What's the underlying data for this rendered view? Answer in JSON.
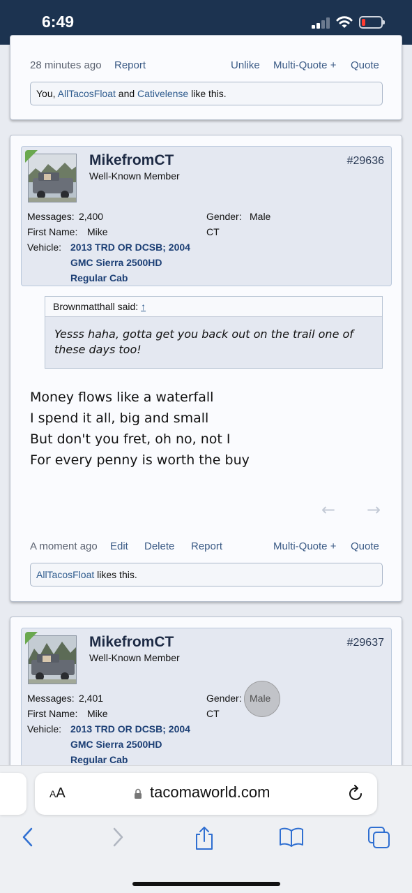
{
  "status_bar": {
    "time": "6:49",
    "battery_color": "#ff3b30"
  },
  "post_top": {
    "timestamp": "28 minutes ago",
    "actions_left": [
      "Report"
    ],
    "actions_right": [
      "Unlike",
      "Multi-Quote +",
      "Quote"
    ],
    "likes": {
      "prefix": "You, ",
      "user1": "AllTacosFloat",
      "joiner": " and ",
      "user2": "Cativelense",
      "suffix": " like this."
    }
  },
  "post_1": {
    "username": "MikefromCT",
    "user_title": "Well-Known Member",
    "post_number": "#29636",
    "messages_label": "Messages:",
    "messages_value": "2,400",
    "first_name_label": "First Name:",
    "first_name_value": "Mike",
    "vehicle_label": "Vehicle:",
    "vehicle_lines": [
      "2013 TRD OR DCSB; 2004",
      "GMC Sierra 2500HD",
      "Regular Cab"
    ],
    "gender_label": "Gender:",
    "gender_value": "Male",
    "location": "CT",
    "quote": {
      "author": "Brownmatthall said:",
      "link_icon": "↑",
      "text": "Yesss haha, gotta get you back out on the trail one of these days too!"
    },
    "body_lines": [
      "Money flows like a waterfall",
      "I spend it all, big and small",
      "But don't you fret, oh no, not I",
      "For every penny is worth the buy"
    ],
    "timestamp": "A moment ago",
    "actions_left": [
      "Edit",
      "Delete",
      "Report"
    ],
    "actions_right": [
      "Multi-Quote +",
      "Quote"
    ],
    "likes": {
      "user1": "AllTacosFloat",
      "suffix": " likes this."
    }
  },
  "post_2": {
    "username": "MikefromCT",
    "user_title": "Well-Known Member",
    "post_number": "#29637",
    "messages_label": "Messages:",
    "messages_value": "2,401",
    "first_name_label": "First Name:",
    "first_name_value": "Mike",
    "vehicle_label": "Vehicle:",
    "vehicle_lines": [
      "2013 TRD OR DCSB; 2004",
      "GMC Sierra 2500HD",
      "Regular Cab"
    ],
    "gender_label": "Gender:",
    "gender_value": "Male",
    "location": "CT"
  },
  "browser": {
    "aa": "AA",
    "url": "tacomaworld.com"
  },
  "colors": {
    "header_bg": "#1c3350",
    "link": "#2d5a8d",
    "accent_green": "#6aa84f"
  }
}
